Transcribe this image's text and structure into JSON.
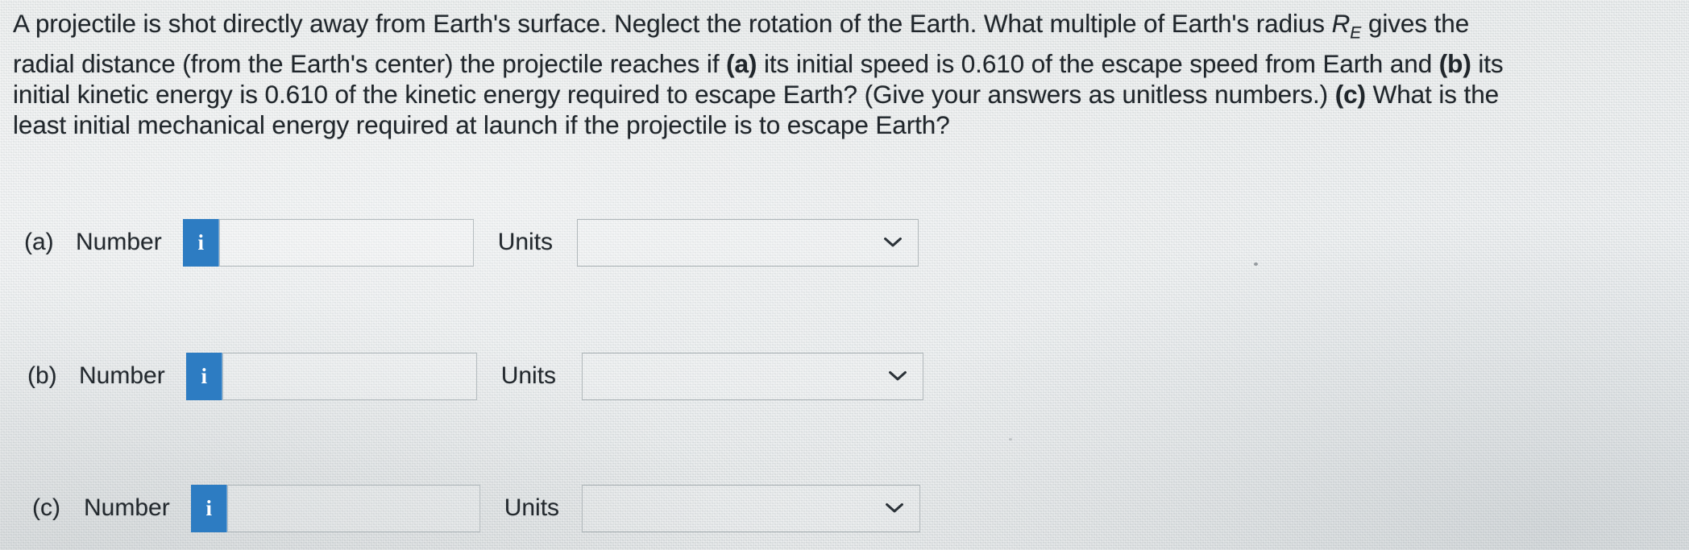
{
  "question": {
    "line1_a": "A projectile is shot directly away from Earth's surface. Neglect the rotation of the Earth. What multiple of Earth's radius ",
    "line1_var": "R",
    "line1_sub": "E",
    "line1_b": " gives the",
    "line2_a": "radial distance (from the Earth's center) the projectile reaches if ",
    "line2_tag_a": "(a)",
    "line2_b": " its initial speed is 0.610 of the escape speed from Earth and ",
    "line2_tag_b": "(b)",
    "line2_c": " its",
    "line3_a": "initial kinetic energy is 0.610 of the kinetic energy required to escape Earth? (Give your answers as unitless numbers.) ",
    "line3_tag_c": "(c)",
    "line3_b": " What is the",
    "line4": "least initial mechanical energy required at launch if the projectile is to escape Earth?"
  },
  "answers": {
    "number_label": "Number",
    "units_label": "Units",
    "info_glyph": "i",
    "chevron_icon": "chevron-down-icon",
    "rows": [
      {
        "part": "(a)",
        "number_value": "",
        "number_placeholder": "",
        "units_value": "",
        "units_options": []
      },
      {
        "part": "(b)",
        "number_value": "",
        "number_placeholder": "",
        "units_value": "",
        "units_options": []
      },
      {
        "part": "(c)",
        "number_value": "",
        "number_placeholder": "",
        "units_value": "",
        "units_options": []
      }
    ]
  },
  "colors": {
    "info_button_blue": "#2d7cc2",
    "text": "#20262b",
    "field_border": "#b6bdc0",
    "background": "#e4e7e6"
  }
}
